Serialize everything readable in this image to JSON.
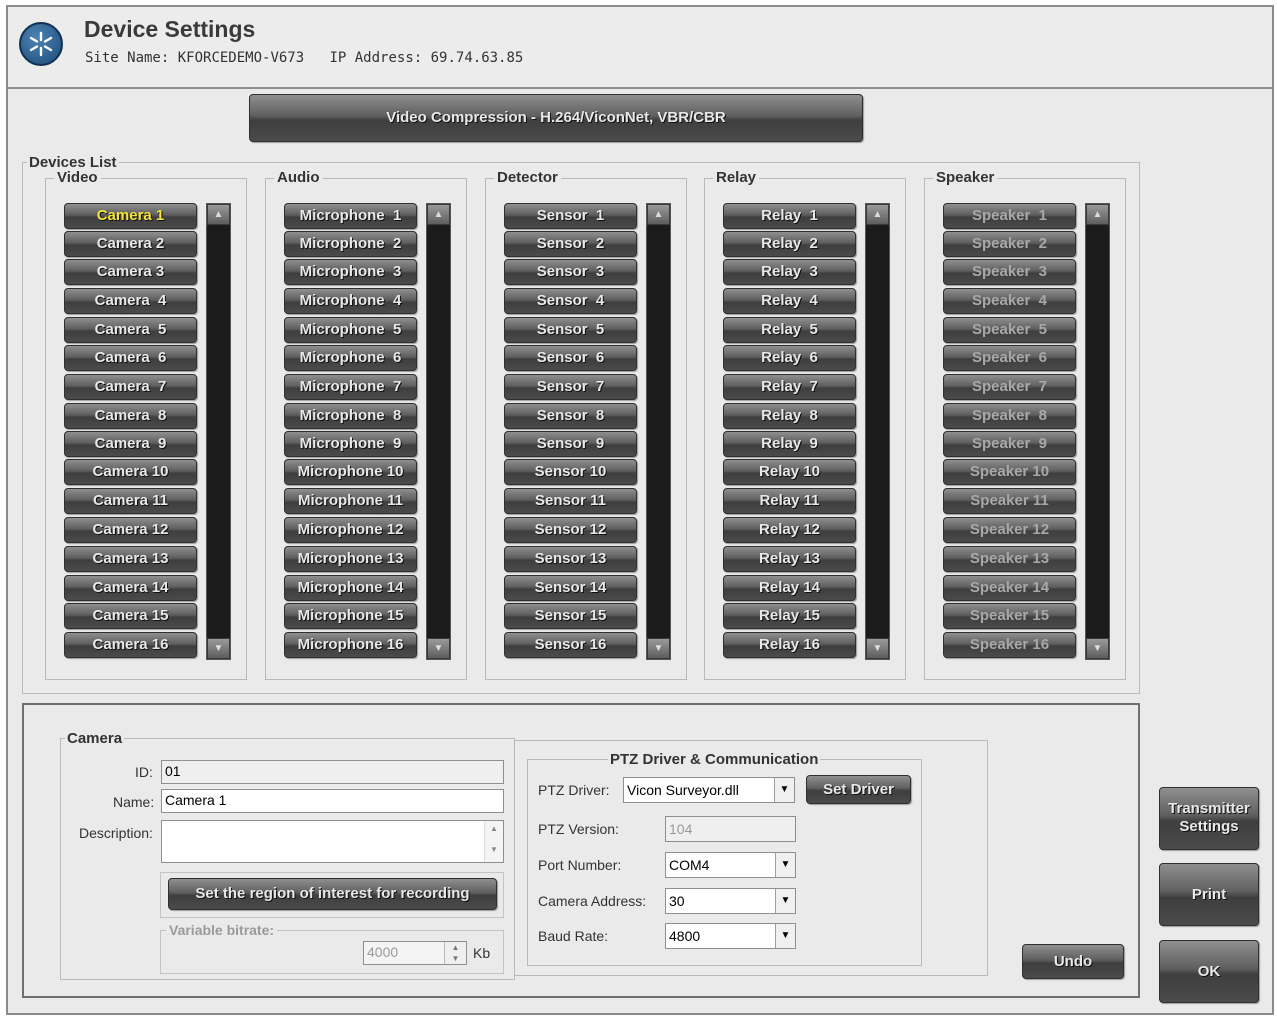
{
  "header": {
    "title": "Device Settings",
    "site_name_label": "Site Name:",
    "site_name": "KFORCEDEMO-V673",
    "ip_label": "IP Address:",
    "ip_address": "69.74.63.85"
  },
  "compression_button": "Video Compression - H.264/ViconNet, VBR/CBR",
  "devices_list": {
    "legend": "Devices List",
    "columns": [
      {
        "legend": "Video",
        "items": [
          "Camera 1",
          "Camera 2",
          "Camera 3",
          "Camera  4",
          "Camera  5",
          "Camera  6",
          "Camera  7",
          "Camera  8",
          "Camera  9",
          "Camera 10",
          "Camera 11",
          "Camera 12",
          "Camera 13",
          "Camera 14",
          "Camera 15",
          "Camera 16"
        ],
        "active_index": 0,
        "disabled": false
      },
      {
        "legend": "Audio",
        "items": [
          "Microphone  1",
          "Microphone  2",
          "Microphone  3",
          "Microphone  4",
          "Microphone  5",
          "Microphone  6",
          "Microphone  7",
          "Microphone  8",
          "Microphone  9",
          "Microphone 10",
          "Microphone 11",
          "Microphone 12",
          "Microphone 13",
          "Microphone 14",
          "Microphone 15",
          "Microphone 16"
        ],
        "active_index": -1,
        "disabled": false
      },
      {
        "legend": "Detector",
        "items": [
          "Sensor  1",
          "Sensor  2",
          "Sensor  3",
          "Sensor  4",
          "Sensor  5",
          "Sensor  6",
          "Sensor  7",
          "Sensor  8",
          "Sensor  9",
          "Sensor 10",
          "Sensor 11",
          "Sensor 12",
          "Sensor 13",
          "Sensor 14",
          "Sensor 15",
          "Sensor 16"
        ],
        "active_index": -1,
        "disabled": false
      },
      {
        "legend": "Relay",
        "items": [
          "Relay  1",
          "Relay  2",
          "Relay  3",
          "Relay  4",
          "Relay  5",
          "Relay  6",
          "Relay  7",
          "Relay  8",
          "Relay  9",
          "Relay 10",
          "Relay 11",
          "Relay 12",
          "Relay 13",
          "Relay 14",
          "Relay 15",
          "Relay 16"
        ],
        "active_index": -1,
        "disabled": false
      },
      {
        "legend": "Speaker",
        "items": [
          "Speaker  1",
          "Speaker  2",
          "Speaker  3",
          "Speaker  4",
          "Speaker  5",
          "Speaker  6",
          "Speaker  7",
          "Speaker  8",
          "Speaker  9",
          "Speaker 10",
          "Speaker 11",
          "Speaker 12",
          "Speaker 13",
          "Speaker 14",
          "Speaker 15",
          "Speaker 16"
        ],
        "active_index": -1,
        "disabled": true
      }
    ]
  },
  "camera": {
    "legend": "Camera",
    "id_label": "ID:",
    "id_value": "01",
    "name_label": "Name:",
    "name_value": "Camera 1",
    "description_label": "Description:",
    "description_value": "",
    "roi_button": "Set the region of interest for recording",
    "vbr_legend": "Variable bitrate:",
    "vbr_value": "4000",
    "vbr_unit": "Kb"
  },
  "ptz": {
    "legend": "PTZ Driver & Communication",
    "driver_label": "PTZ Driver:",
    "driver_value": "Vicon Surveyor.dll",
    "set_driver_button": "Set Driver",
    "version_label": "PTZ Version:",
    "version_value": "104",
    "port_label": "Port Number:",
    "port_value": "COM4",
    "address_label": "Camera Address:",
    "address_value": "30",
    "baud_label": "Baud Rate:",
    "baud_value": "4800"
  },
  "buttons": {
    "undo": "Undo",
    "transmitter_settings": "Transmitter Settings",
    "print": "Print",
    "ok": "OK"
  },
  "colors": {
    "active_item": "#f4e43a",
    "button_dark": "#4b4b4b",
    "logo_blue": "#1d4a78"
  }
}
